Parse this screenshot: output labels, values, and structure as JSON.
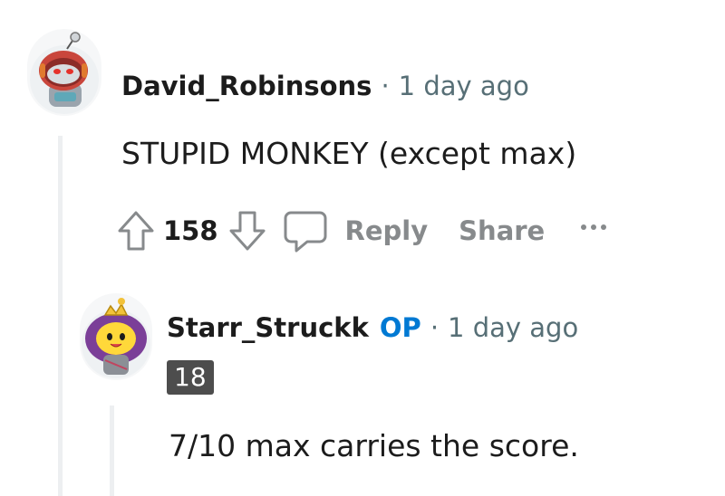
{
  "comments": [
    {
      "username": "David_Robinsons",
      "separator": "·",
      "time": "1 day ago",
      "body": "STUPID MONKEY (except max)",
      "score": "158",
      "actions": {
        "reply_label": "Reply",
        "share_label": "Share"
      }
    },
    {
      "username": "Starr_Struckk",
      "op_badge": "OP",
      "separator": "·",
      "time": "1 day ago",
      "flair": "18",
      "body": "7/10 max carries the score."
    }
  ],
  "colors": {
    "op": "#0079d3",
    "meta_gray": "#576f76",
    "action_gray": "#878a8c",
    "thread_line": "#edeff1",
    "flair_bg": "#4d4d4d"
  },
  "icons": [
    "upvote-icon",
    "downvote-icon",
    "reply-icon",
    "more-options-icon"
  ]
}
